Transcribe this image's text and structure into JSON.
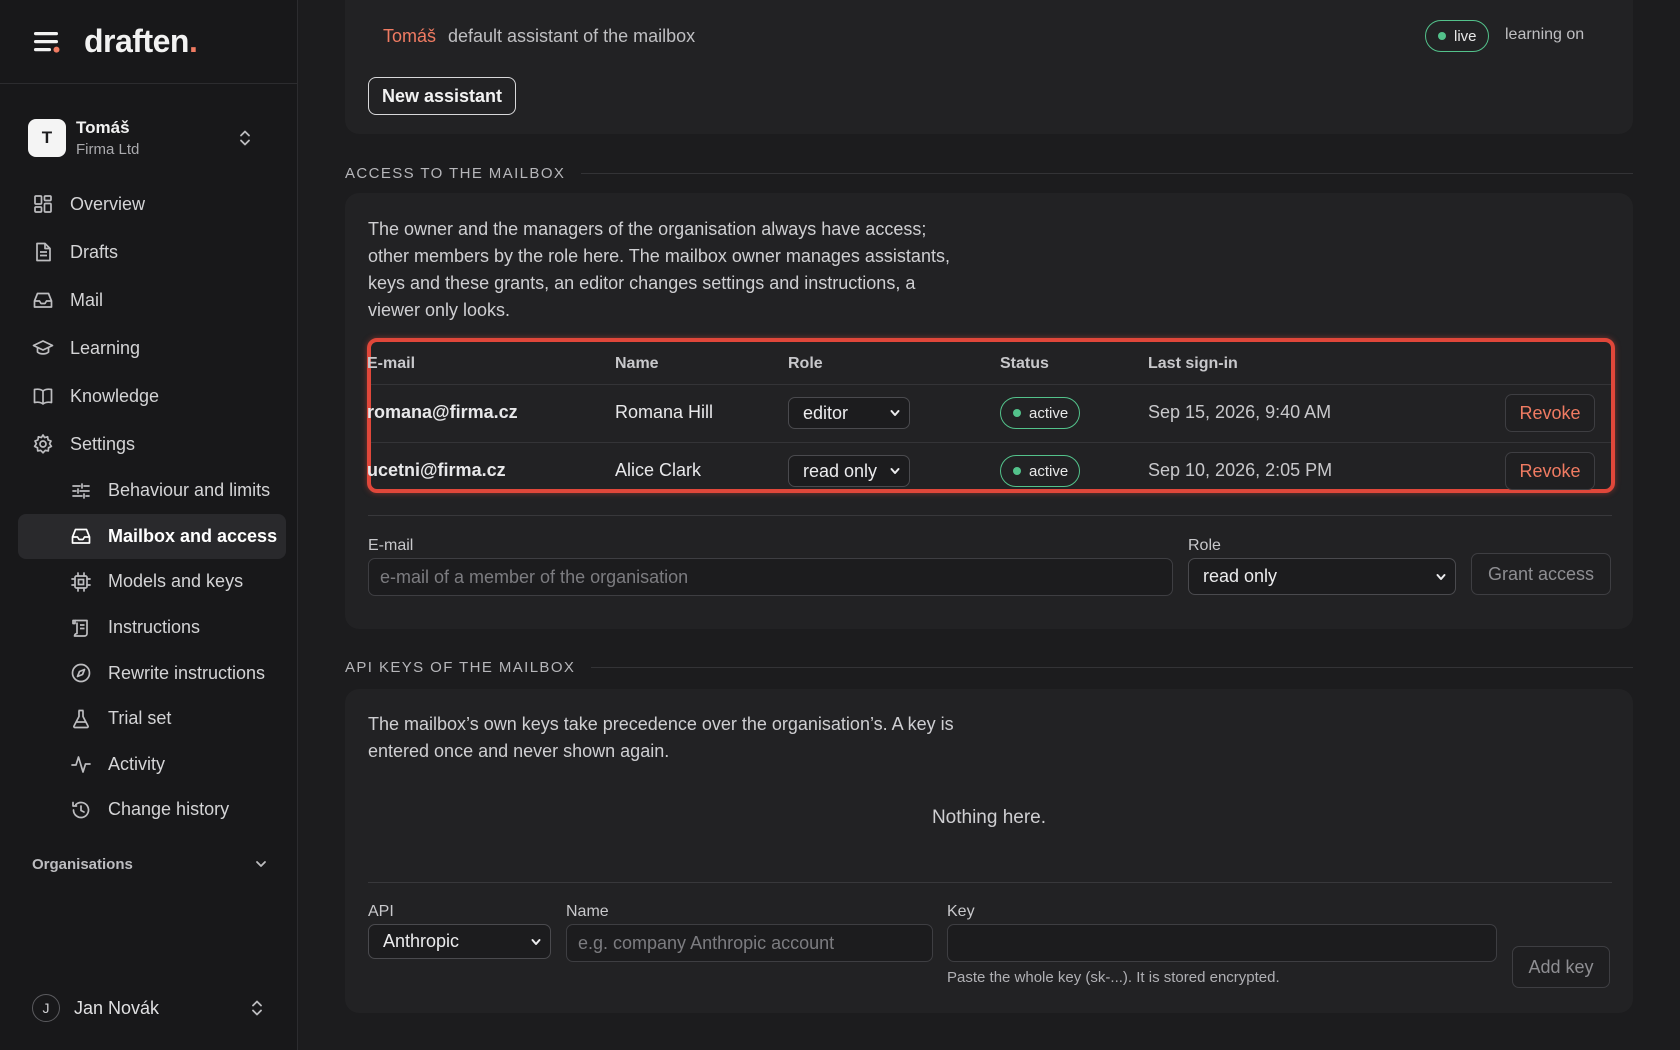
{
  "app": {
    "brand": "draften",
    "brand_dot": "."
  },
  "account": {
    "initial": "T",
    "name": "Tomáš",
    "org": "Firma Ltd"
  },
  "nav": {
    "items": [
      {
        "label": "Overview",
        "icon": "grid-icon"
      },
      {
        "label": "Drafts",
        "icon": "document-icon"
      },
      {
        "label": "Mail",
        "icon": "inbox-icon"
      },
      {
        "label": "Learning",
        "icon": "graduation-cap-icon"
      },
      {
        "label": "Knowledge",
        "icon": "book-icon"
      },
      {
        "label": "Settings",
        "icon": "gear-icon"
      }
    ],
    "settings_sub": [
      {
        "label": "Behaviour and limits",
        "icon": "sliders-icon"
      },
      {
        "label": "Mailbox and access",
        "icon": "inbox-icon",
        "active": true
      },
      {
        "label": "Models and keys",
        "icon": "chip-icon"
      },
      {
        "label": "Instructions",
        "icon": "scroll-icon"
      },
      {
        "label": "Rewrite instructions",
        "icon": "compass-icon"
      },
      {
        "label": "Trial set",
        "icon": "flask-icon"
      },
      {
        "label": "Activity",
        "icon": "pulse-icon"
      },
      {
        "label": "Change history",
        "icon": "history-icon"
      }
    ]
  },
  "organisations": {
    "label": "Organisations"
  },
  "user": {
    "initial": "J",
    "name": "Jan Novák"
  },
  "assistant": {
    "name": "Tomáš",
    "description": "default assistant of the mailbox",
    "status": "live",
    "learning": "learning on",
    "new_button": "New assistant"
  },
  "access": {
    "section_title": "ACCESS TO THE MAILBOX",
    "description": "The owner and the managers of the organisation always have access; other members by the role here. The mailbox owner manages assistants, keys and these grants, an editor changes settings and instructions, a viewer only looks.",
    "columns": [
      "E-mail",
      "Name",
      "Role",
      "Status",
      "Last sign-in"
    ],
    "rows": [
      {
        "email": "romana@firma.cz",
        "name": "Romana Hill",
        "role": "editor",
        "status": "active",
        "last_sign_in": "Sep 15, 2026, 9:40 AM",
        "action": "Revoke"
      },
      {
        "email": "ucetni@firma.cz",
        "name": "Alice Clark",
        "role": "read only",
        "status": "active",
        "last_sign_in": "Sep 10, 2026, 2:05 PM",
        "action": "Revoke"
      }
    ],
    "form": {
      "email_label": "E-mail",
      "email_placeholder": "e-mail of a member of the organisation",
      "role_label": "Role",
      "role_value": "read only",
      "grant_button": "Grant access"
    }
  },
  "keys": {
    "section_title": "API KEYS OF THE MAILBOX",
    "description": "The mailbox’s own keys take precedence over the organisation’s. A key is entered once and never shown again.",
    "empty": "Nothing here.",
    "form": {
      "api_label": "API",
      "api_value": "Anthropic",
      "name_label": "Name",
      "name_placeholder": "e.g. company Anthropic account",
      "key_label": "Key",
      "key_hint": "Paste the whole key (sk-...). It is stored encrypted.",
      "add_button": "Add key"
    }
  },
  "colors": {
    "accent": "#f07b62",
    "live": "#53c28b",
    "highlight": "#e0473a"
  }
}
